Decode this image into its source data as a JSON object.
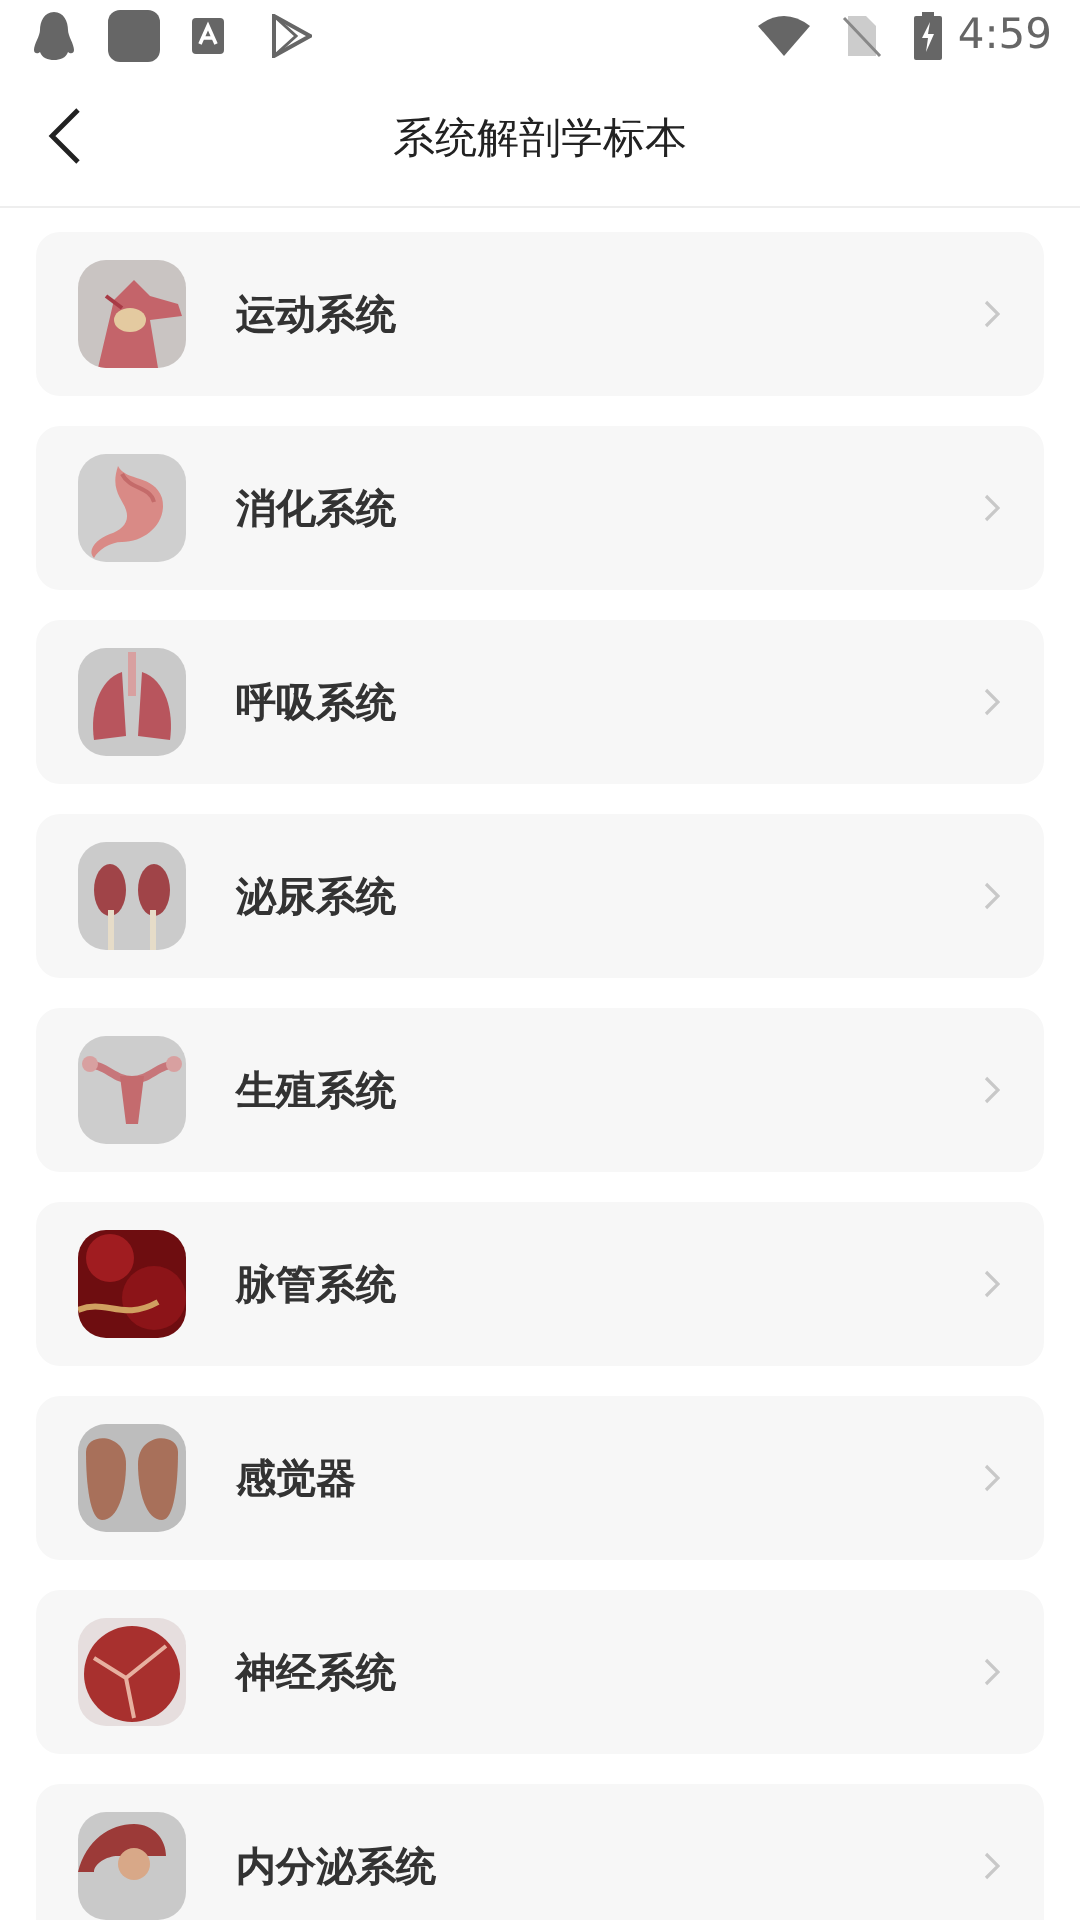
{
  "status_bar": {
    "time": "4:59"
  },
  "header": {
    "title": "系统解剖学标本"
  },
  "items": [
    {
      "label": "运动系统"
    },
    {
      "label": "消化系统"
    },
    {
      "label": "呼吸系统"
    },
    {
      "label": "泌尿系统"
    },
    {
      "label": "生殖系统"
    },
    {
      "label": "脉管系统"
    },
    {
      "label": "感觉器"
    },
    {
      "label": "神经系统"
    },
    {
      "label": "内分泌系统"
    }
  ]
}
